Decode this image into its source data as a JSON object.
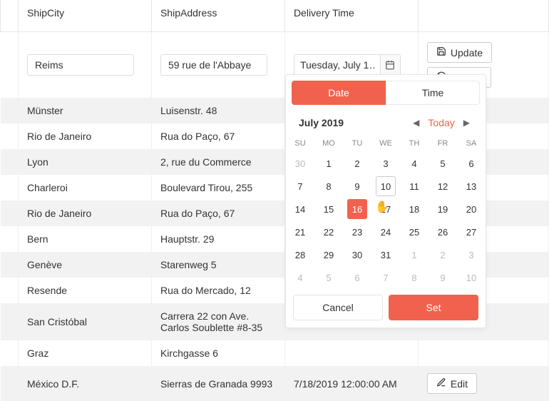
{
  "columns": {
    "city": "ShipCity",
    "address": "ShipAddress",
    "delivery": "Delivery Time"
  },
  "edit_row": {
    "city_value": "Reims",
    "address_value": "59 rue de l'Abbaye",
    "delivery_display": "Tuesday, July 1…"
  },
  "rows": [
    {
      "city": "Münster",
      "address": "Luisenstr. 48",
      "delivery": ""
    },
    {
      "city": "Rio de Janeiro",
      "address": "Rua do Paço, 67",
      "delivery": ""
    },
    {
      "city": "Lyon",
      "address": "2, rue du Commerce",
      "delivery": ""
    },
    {
      "city": "Charleroi",
      "address": "Boulevard Tirou, 255",
      "delivery": ""
    },
    {
      "city": "Rio de Janeiro",
      "address": "Rua do Paço, 67",
      "delivery": ""
    },
    {
      "city": "Bern",
      "address": "Hauptstr. 29",
      "delivery": ""
    },
    {
      "city": "Genève",
      "address": "Starenweg 5",
      "delivery": ""
    },
    {
      "city": "Resende",
      "address": "Rua do Mercado, 12",
      "delivery": ""
    },
    {
      "city": "San Cristóbal",
      "address": "Carrera 22 con Ave. Carlos Soublette #8-35",
      "delivery": ""
    },
    {
      "city": "Graz",
      "address": "Kirchgasse 6",
      "delivery": ""
    },
    {
      "city": "México D.F.",
      "address": "Sierras de Granada 9993",
      "delivery": "7/18/2019 12:00:00 AM"
    }
  ],
  "actions": {
    "update": "Update",
    "cancel": "Cancel",
    "edit": "Edit"
  },
  "datepicker": {
    "tabs": {
      "date": "Date",
      "time": "Time"
    },
    "month_label": "July 2019",
    "today": "Today",
    "dow": [
      "SU",
      "MO",
      "TU",
      "WE",
      "TH",
      "FR",
      "SA"
    ],
    "weeks": [
      [
        {
          "d": 30,
          "o": true
        },
        {
          "d": 1
        },
        {
          "d": 2
        },
        {
          "d": 3
        },
        {
          "d": 4
        },
        {
          "d": 5
        },
        {
          "d": 6
        }
      ],
      [
        {
          "d": 7
        },
        {
          "d": 8
        },
        {
          "d": 9
        },
        {
          "d": 10,
          "h": true
        },
        {
          "d": 11
        },
        {
          "d": 12
        },
        {
          "d": 13
        }
      ],
      [
        {
          "d": 14
        },
        {
          "d": 15
        },
        {
          "d": 16,
          "s": true
        },
        {
          "d": 17
        },
        {
          "d": 18
        },
        {
          "d": 19
        },
        {
          "d": 20
        }
      ],
      [
        {
          "d": 21
        },
        {
          "d": 22
        },
        {
          "d": 23
        },
        {
          "d": 24
        },
        {
          "d": 25
        },
        {
          "d": 26
        },
        {
          "d": 27
        }
      ],
      [
        {
          "d": 28
        },
        {
          "d": 29
        },
        {
          "d": 30
        },
        {
          "d": 31
        },
        {
          "d": 1,
          "o": true
        },
        {
          "d": 2,
          "o": true
        },
        {
          "d": 3,
          "o": true
        }
      ],
      [
        {
          "d": 4,
          "o": true
        },
        {
          "d": 5,
          "o": true
        },
        {
          "d": 6,
          "o": true
        },
        {
          "d": 7,
          "o": true
        },
        {
          "d": 8,
          "o": true
        },
        {
          "d": 9,
          "o": true
        },
        {
          "d": 10,
          "o": true
        }
      ]
    ],
    "footer": {
      "cancel": "Cancel",
      "set": "Set"
    }
  }
}
